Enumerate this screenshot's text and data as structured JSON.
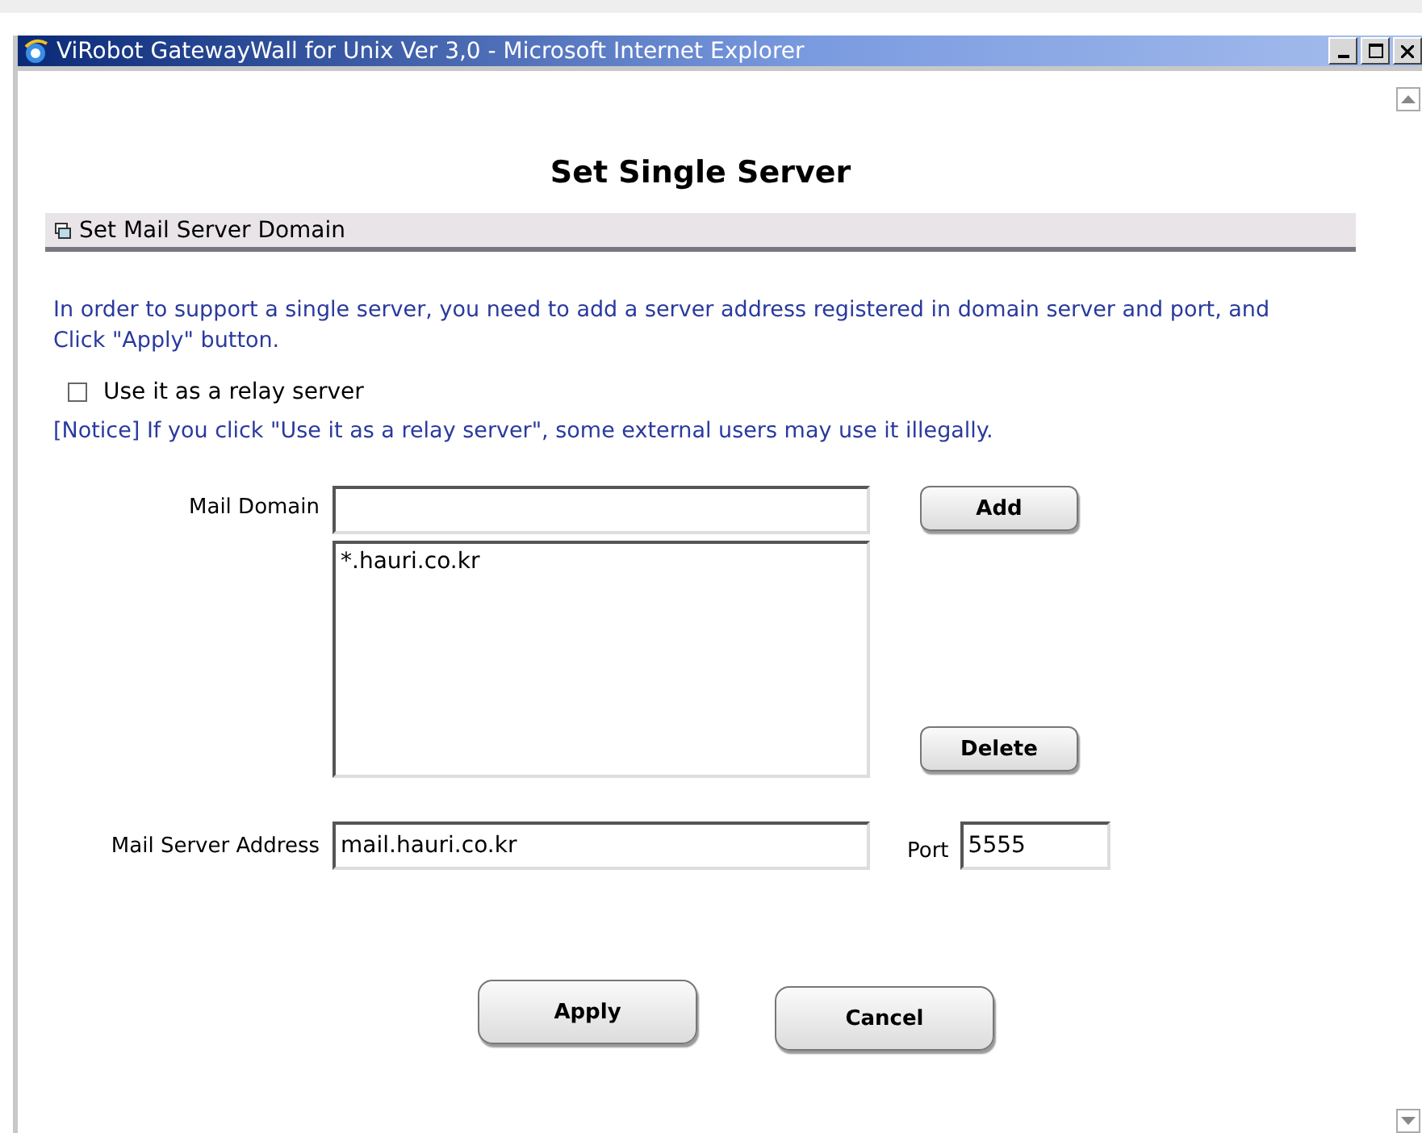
{
  "window": {
    "title": "ViRobot GatewayWall for Unix Ver 3,0 - Microsoft Internet Explorer"
  },
  "heading": "Set Single Server",
  "section": "Set Mail Server Domain",
  "intro": "In order to support a single server, you need to add a server address registered in domain server and port, and Click \"Apply\" button.",
  "relay": {
    "label": "Use it as a relay server",
    "checked": false
  },
  "notice": "[Notice] If you click \"Use it as a relay server\", some external users may use it illegally.",
  "mail_domain": {
    "label": "Mail Domain",
    "list": [
      "*.hauri.co.kr"
    ],
    "add": "Add",
    "delete": "Delete"
  },
  "server": {
    "label": "Mail Server Address",
    "value": "mail.hauri.co.kr",
    "port_label": "Port",
    "port": "5555"
  },
  "buttons": [
    "Apply",
    "Cancel"
  ]
}
